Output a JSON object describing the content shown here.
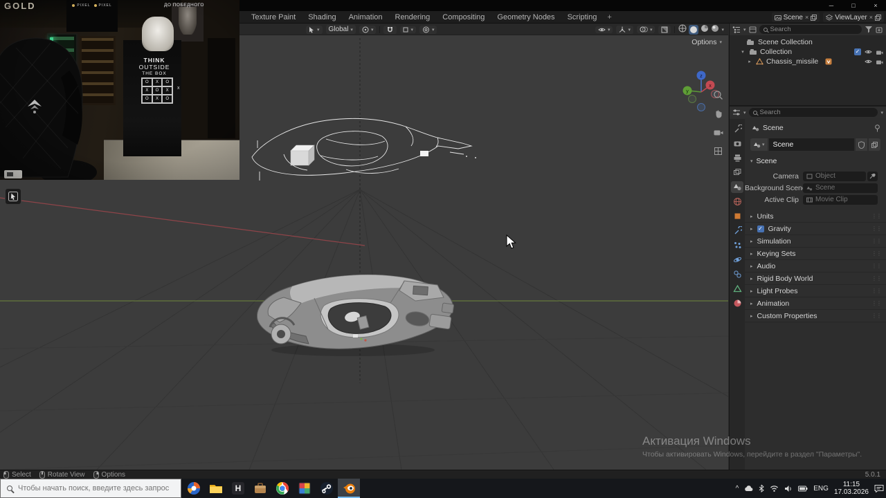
{
  "icons": {
    "chevron_down": "▾",
    "arrow_collapsed": "▸",
    "arrow_expanded": "▾",
    "check": "✓",
    "close": "×",
    "minimize": "─",
    "maximize": "□",
    "plus": "+",
    "tray_expand": "^",
    "drag_dots": "⋮⋮"
  },
  "webcam": {
    "gold": "GOLD",
    "banner": "ДО ПОБЕДНОГО",
    "pixel_left": "PIXEL",
    "pixel_right": "PIXEL",
    "sign_line1": "THINK",
    "sign_line2": "OUTSIDE",
    "sign_line3": "THE BOX",
    "sign_x": "x",
    "ttt": [
      "O",
      "X",
      "O",
      "X",
      "O",
      "X",
      "O",
      "X",
      "O"
    ]
  },
  "blender": {
    "topbar": {
      "tabs": [
        "Texture Paint",
        "Shading",
        "Animation",
        "Rendering",
        "Compositing",
        "Geometry Nodes",
        "Scripting"
      ],
      "scene_selector": "Scene",
      "viewlayer_selector": "ViewLayer"
    },
    "viewport": {
      "orientation": "Global",
      "options": "Options",
      "axis_x": "x",
      "axis_y": "y",
      "axis_z": "z"
    },
    "outliner": {
      "search_placeholder": "Search",
      "tree": [
        {
          "label": "Scene Collection"
        },
        {
          "label": "Collection"
        },
        {
          "label": "Chassis_missile"
        }
      ]
    },
    "properties": {
      "search_placeholder": "Search",
      "breadcrumb": "Scene",
      "id_name": "Scene",
      "section_title": "Scene",
      "camera_label": "Camera",
      "camera_value": "Object",
      "background_label": "Background Scene",
      "background_value": "Scene",
      "clip_label": "Active Clip",
      "clip_value": "Movie Clip",
      "sections": [
        "Units",
        "Gravity",
        "Simulation",
        "Keying Sets",
        "Audio",
        "Rigid Body World",
        "Light Probes",
        "Animation",
        "Custom Properties"
      ]
    },
    "statusbar": {
      "select": "Select",
      "rotate": "Rotate View",
      "options": "Options",
      "version": "5.0.1"
    }
  },
  "taskbar": {
    "search_placeholder": "Чтобы начать поиск, введите здесь запрос",
    "h_app_label": "H",
    "tray": {
      "lang": "ENG",
      "time": "11:15",
      "date": "17.03.2026"
    }
  },
  "watermark": {
    "title": "Активация Windows",
    "subtitle": "Чтобы активировать Windows, перейдите в раздел \"Параметры\"."
  }
}
